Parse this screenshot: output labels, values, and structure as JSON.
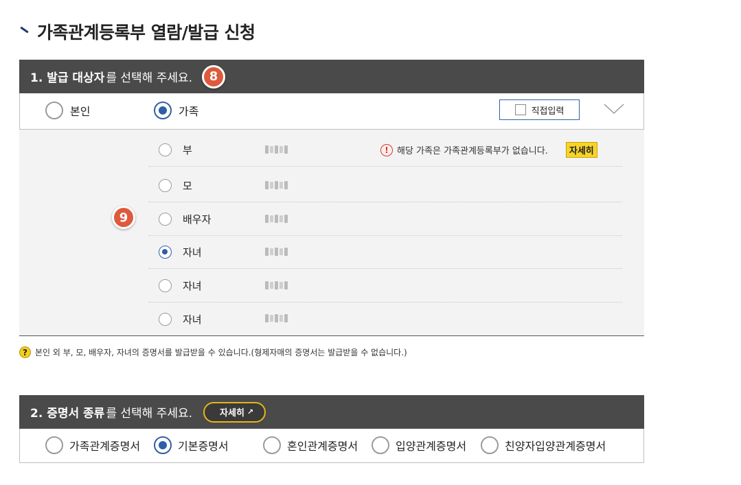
{
  "page": {
    "title": "가족관계등록부 열람/발급 신청"
  },
  "section1": {
    "header_bold": "1. 발급 대상자",
    "header_rest": "를 선택해 주세요.",
    "step_badge": "8",
    "options": [
      {
        "label": "본인",
        "checked": false
      },
      {
        "label": "가족",
        "checked": true
      }
    ],
    "direct_input_label": "직접입력",
    "family_badge": "9",
    "family": [
      {
        "relation": "부",
        "checked": false
      },
      {
        "relation": "모",
        "checked": false
      },
      {
        "relation": "배우자",
        "checked": false
      },
      {
        "relation": "자녀",
        "checked": true
      },
      {
        "relation": "자녀",
        "checked": false
      },
      {
        "relation": "자녀",
        "checked": false
      }
    ],
    "warning_text": "해당 가족은 가족관계등록부가 없습니다.",
    "warning_detail": "자세히",
    "note": "본인 외 부, 모, 배우자, 자녀의 증명서를 발급받을 수 있습니다.(형제자매의 증명서는 발급받을 수 없습니다.)"
  },
  "section2": {
    "header_bold": "2. 증명서 종류",
    "header_rest": "를 선택해 주세요.",
    "detail_label": "자세히",
    "options": [
      {
        "label": "가족관계증명서",
        "checked": false
      },
      {
        "label": "기본증명서",
        "checked": true
      },
      {
        "label": "혼인관계증명서",
        "checked": false
      },
      {
        "label": "입양관계증명서",
        "checked": false
      },
      {
        "label": "친양자입양관계증명서",
        "checked": false
      }
    ]
  },
  "colors": {
    "header_bg": "#4a4a4a",
    "accent_blue": "#2f5ea8",
    "badge_orange": "#de5a3c",
    "tag_yellow": "#f7d42a"
  }
}
